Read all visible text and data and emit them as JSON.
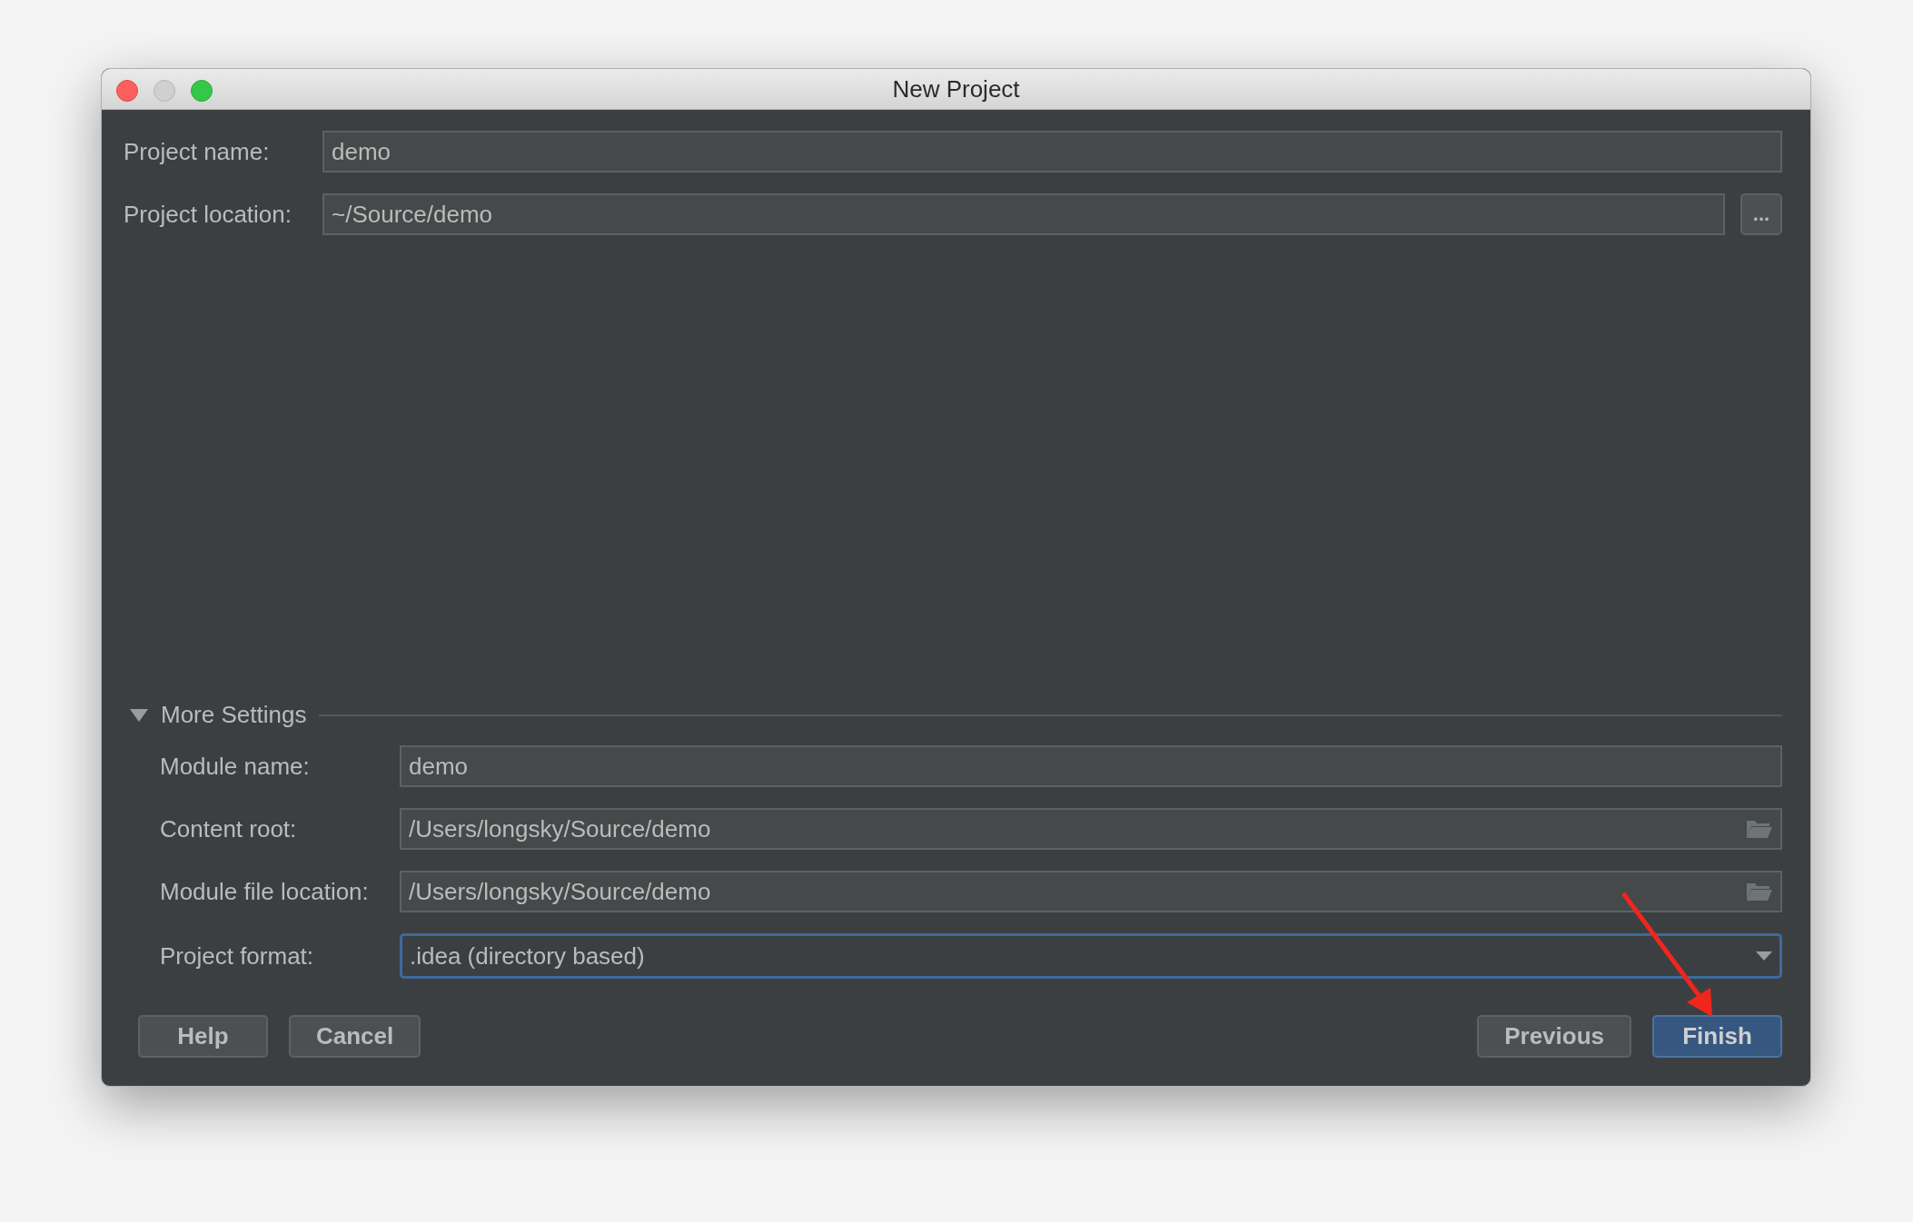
{
  "window": {
    "title": "New Project"
  },
  "fields": [
    {
      "kind": "text",
      "label": "Project name:",
      "value": "demo"
    },
    {
      "kind": "browse",
      "label": "Project location:",
      "value": "~/Source/demo",
      "button": "..."
    }
  ],
  "more_settings": {
    "label": "More Settings",
    "expanded": true,
    "fields": [
      {
        "kind": "text",
        "label": "Module name:",
        "value": "demo",
        "focused": false
      },
      {
        "kind": "folder",
        "label": "Content root:",
        "value": "/Users/longsky/Source/demo",
        "focused": false
      },
      {
        "kind": "folder",
        "label": "Module file location:",
        "value": "/Users/longsky/Source/demo",
        "focused": false
      },
      {
        "kind": "dropdown",
        "label": "Project format:",
        "value": ".idea (directory based)",
        "focused": true
      }
    ]
  },
  "buttons_left": [
    {
      "label": "Help",
      "default": false
    },
    {
      "label": "Cancel",
      "default": false
    }
  ],
  "buttons_right": [
    {
      "label": "Previous",
      "default": false
    },
    {
      "label": "Finish",
      "default": true
    }
  ]
}
